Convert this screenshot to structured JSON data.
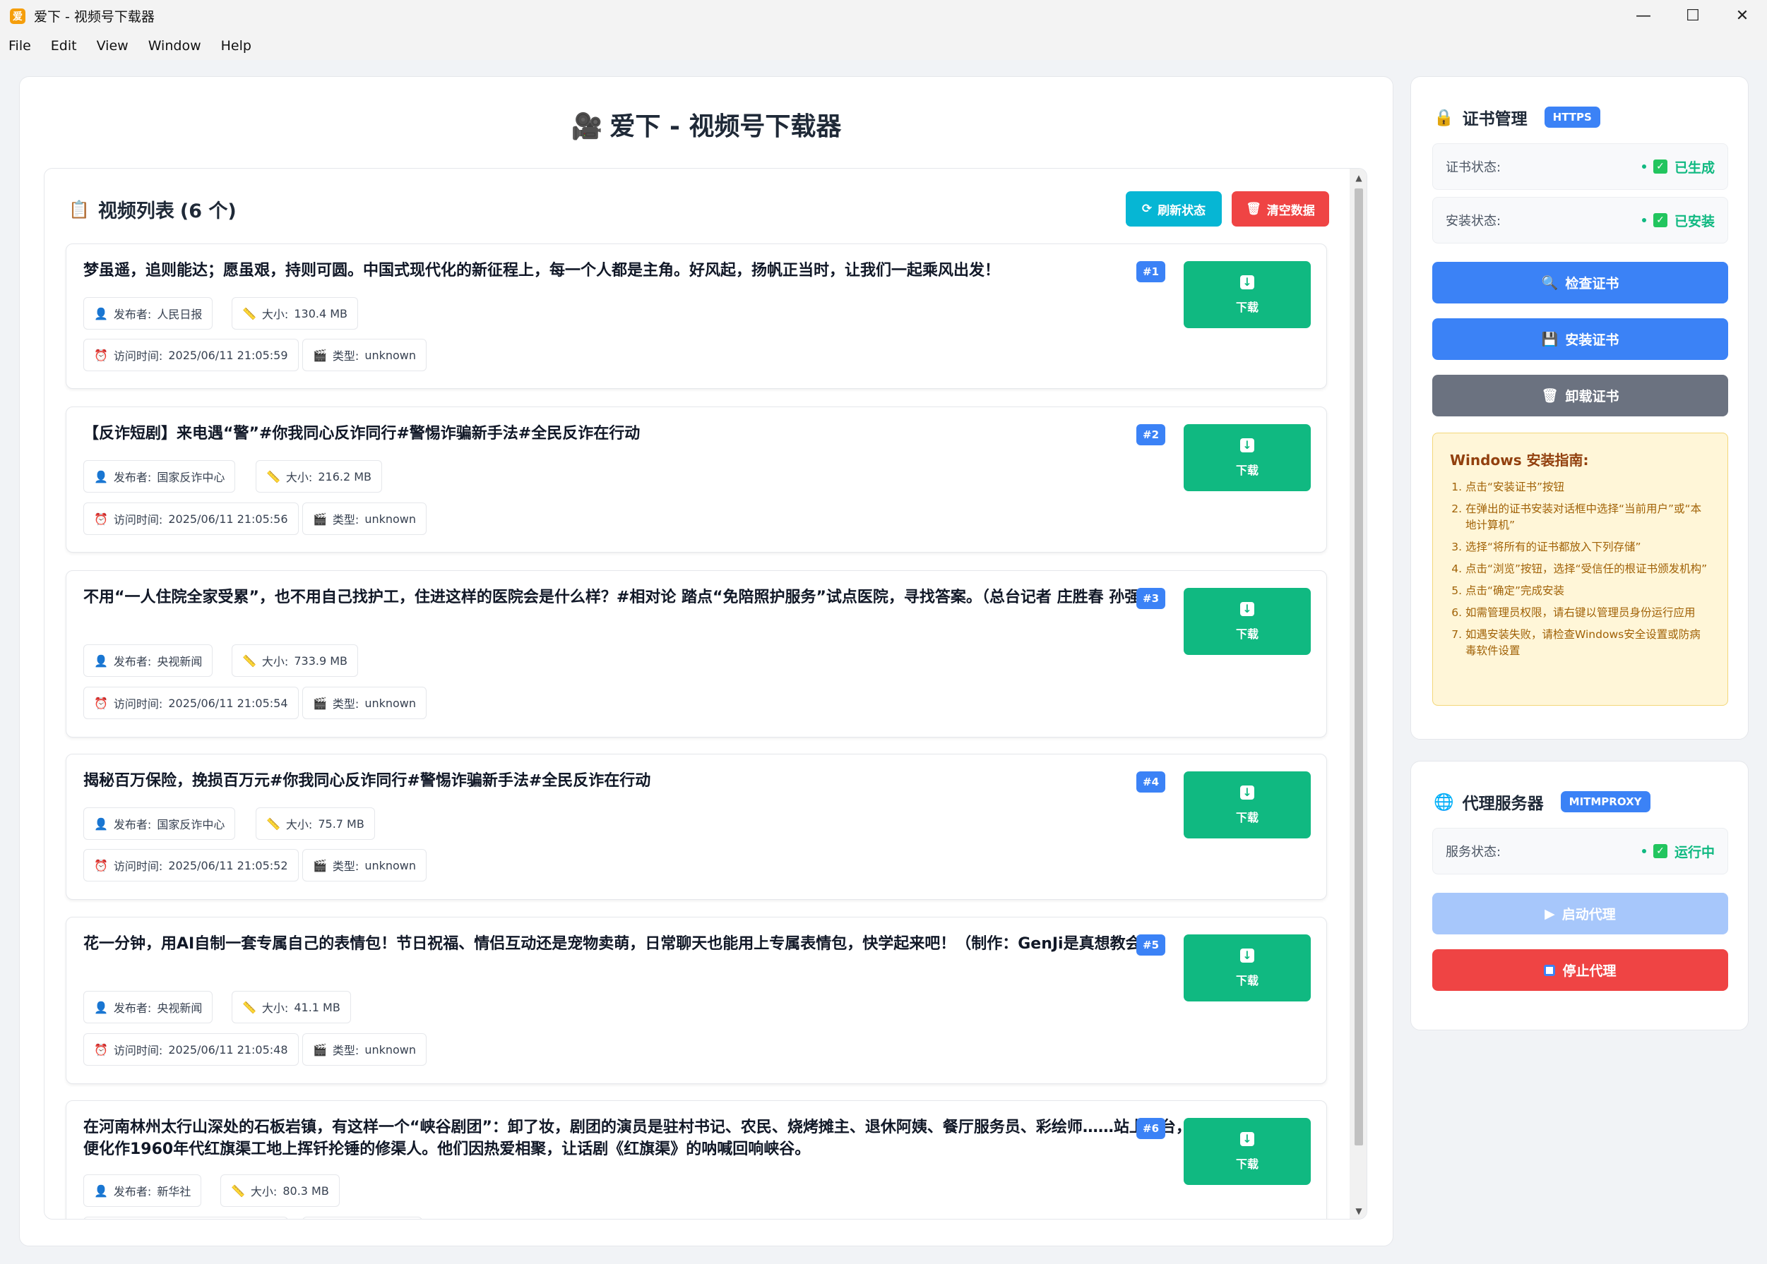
{
  "window": {
    "title": "爱下 - 视频号下载器",
    "app_icon_glyph": "爱"
  },
  "menu": [
    "File",
    "Edit",
    "View",
    "Window",
    "Help"
  ],
  "header": {
    "title": "爱下 - 视频号下载器",
    "icon": "video-camera-icon"
  },
  "video_list": {
    "title": "视频列表",
    "count_text": "(6 个)",
    "refresh_label": "刷新状态",
    "clear_label": "清空数据",
    "publisher_prefix": "发布者:",
    "size_prefix": "大小:",
    "time_prefix": "访问时间:",
    "type_prefix": "类型:",
    "download_label": "下载",
    "items": [
      {
        "num": "#1",
        "title": "梦虽遥，追则能达；愿虽艰，持则可圆。中国式现代化的新征程上，每一个人都是主角。好风起，扬帆正当时，让我们一起乘风出发！",
        "publisher": "人民日报",
        "size": "130.4 MB",
        "time": "2025/06/11 21:05:59",
        "type": "unknown"
      },
      {
        "num": "#2",
        "title": "【反诈短剧】来电遇“警”#你我同心反诈同行#警惕诈骗新手法#全民反诈在行动",
        "publisher": "国家反诈中心",
        "size": "216.2 MB",
        "time": "2025/06/11 21:05:56",
        "type": "unknown"
      },
      {
        "num": "#3",
        "title": "不用“一人住院全家受累”，也不用自己找护工，住进这样的医院会是什么样？#相对论 踏点“免陪照护服务”试点医院，寻找答案。（总台记者 庄胜春 孙强）",
        "publisher": "央视新闻",
        "size": "733.9 MB",
        "time": "2025/06/11 21:05:54",
        "type": "unknown"
      },
      {
        "num": "#4",
        "title": "揭秘百万保险，挽损百万元#你我同心反诈同行#警惕诈骗新手法#全民反诈在行动",
        "publisher": "国家反诈中心",
        "size": "75.7 MB",
        "time": "2025/06/11 21:05:52",
        "type": "unknown"
      },
      {
        "num": "#5",
        "title": "花一分钟，用AI自制一套专属自己的表情包！节日祝福、情侣互动还是宠物卖萌，日常聊天也能用上专属表情包，快学起来吧！（制作：GenJi是真想教会你）",
        "publisher": "央视新闻",
        "size": "41.1 MB",
        "time": "2025/06/11 21:05:48",
        "type": "unknown"
      },
      {
        "num": "#6",
        "title": "在河南林州太行山深处的石板岩镇，有这样一个“峡谷剧团”：卸了妆，剧团的演员是驻村书记、农民、烧烤摊主、退休阿姨、餐厅服务员、彩绘师……站上舞台，便化作1960年代红旗渠工地上挥钎抡锤的修渠人。他们因热爱相聚，让话剧《红旗渠》的呐喊回响峡谷。",
        "publisher": "新华社",
        "size": "80.3 MB",
        "time": "",
        "type": ""
      }
    ]
  },
  "cert": {
    "title": "证书管理",
    "badge": "HTTPS",
    "cert_status_label": "证书状态:",
    "cert_status_value": "已生成",
    "install_status_label": "安装状态:",
    "install_status_value": "已安装",
    "check_label": "检查证书",
    "install_label": "安装证书",
    "uninstall_label": "卸载证书",
    "guide_title": "Windows 安装指南:",
    "guide_steps": [
      "点击“安装证书”按钮",
      "在弹出的证书安装对话框中选择“当前用户”或“本地计算机”",
      "选择“将所有的证书都放入下列存储”",
      "点击“浏览”按钮，选择“受信任的根证书颁发机构”",
      "点击“确定”完成安装",
      "如需管理员权限，请右键以管理员身份运行应用",
      "如遇安装失败，请检查Windows安全设置或防病毒软件设置"
    ]
  },
  "proxy": {
    "title": "代理服务器",
    "badge": "MITMPROXY",
    "service_status_label": "服务状态:",
    "service_status_value": "运行中",
    "start_label": "启动代理",
    "stop_label": "停止代理"
  },
  "colors": {
    "primary": "#3b82f6",
    "success": "#10b981",
    "danger": "#ef4444",
    "info": "#06b6d4",
    "secondary": "#6b7280",
    "disabled": "#93c5fd"
  }
}
